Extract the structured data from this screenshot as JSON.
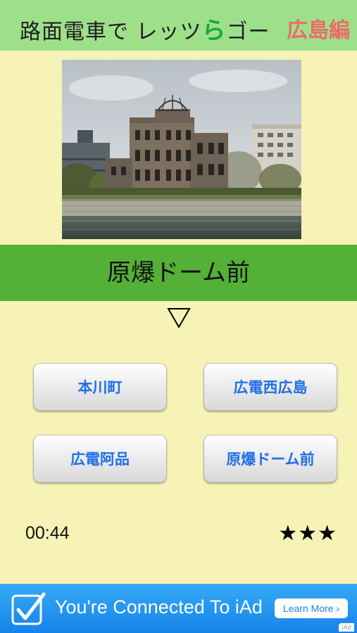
{
  "header": {
    "title_part1": "路面電車で レッツ",
    "title_ra": "ら",
    "title_part2": "ゴー",
    "subtitle": "広島編"
  },
  "photo": {
    "icon": "atomic-bomb-dome-photo"
  },
  "question": {
    "station": "原爆ドーム前",
    "arrow": "▽"
  },
  "choices": [
    "本川町",
    "広電西広島",
    "広電阿品",
    "原爆ドーム前"
  ],
  "status": {
    "timer": "00:44",
    "stars": "★★★"
  },
  "ad": {
    "text": "You're Connected To iAd",
    "button": "Learn More",
    "mark": "iAd"
  },
  "colors": {
    "background": "#f7f2b6",
    "header": "#9ee08a",
    "station_bar": "#55b037",
    "choice_text": "#1f6fe6",
    "subtitle": "#ee6a6a",
    "ad": "#1683ea"
  }
}
